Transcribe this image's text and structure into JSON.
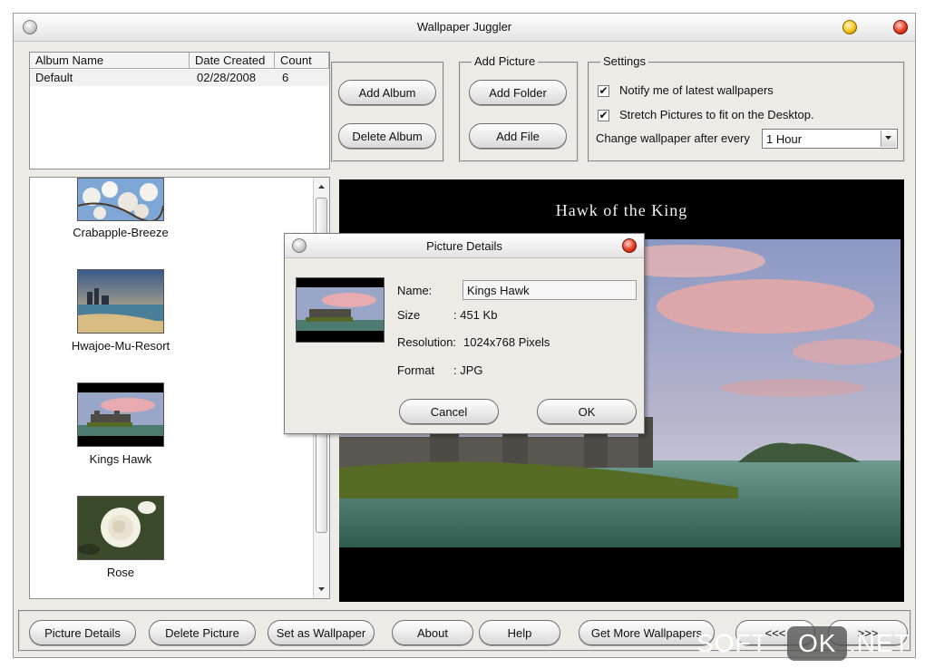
{
  "window": {
    "title": "Wallpaper Juggler"
  },
  "albums": {
    "columns": [
      "Album Name",
      "Date Created",
      "Count"
    ],
    "rows": [
      {
        "name": "Default",
        "date": "02/28/2008",
        "count": "6"
      }
    ]
  },
  "album_buttons": {
    "add": "Add Album",
    "delete": "Delete Album"
  },
  "add_picture": {
    "legend": "Add Picture",
    "add_folder": "Add Folder",
    "add_file": "Add File"
  },
  "settings": {
    "legend": "Settings",
    "notify_label": "Notify me of latest wallpapers",
    "notify_checked": true,
    "stretch_label": "Stretch Pictures to fit on the Desktop.",
    "stretch_checked": true,
    "interval_label": "Change wallpaper after every",
    "interval_value": "1 Hour"
  },
  "thumbnails": [
    {
      "name": "Crabapple-Breeze"
    },
    {
      "name": "Hwajoe-Mu-Resort"
    },
    {
      "name": "Kings Hawk"
    },
    {
      "name": "Rose"
    }
  ],
  "preview": {
    "caption": "Hawk of the King"
  },
  "dialog": {
    "title": "Picture Details",
    "name_label": "Name:",
    "name_value": "Kings Hawk",
    "size_label": "Size",
    "size_value": ": 451 Kb",
    "resolution_label": "Resolution:",
    "resolution_value": "1024x768 Pixels",
    "format_label": "Format",
    "format_value": ": JPG",
    "cancel": "Cancel",
    "ok": "OK"
  },
  "bottom_buttons": {
    "picture_details": "Picture Details",
    "delete_picture": "Delete Picture",
    "set_wallpaper": "Set as Wallpaper",
    "about": "About",
    "help": "Help",
    "get_more": "Get More Wallpapers",
    "prev": "<<<",
    "next": ">>>"
  },
  "watermark": {
    "left": "SOFT",
    "badge": "OK",
    "right": ".NET"
  }
}
